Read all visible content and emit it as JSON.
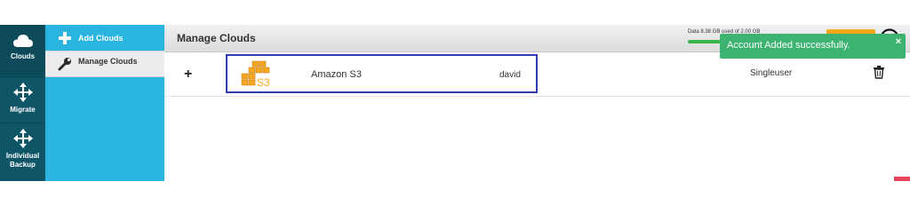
{
  "left_nav": {
    "items": [
      {
        "label": "Clouds",
        "icon": "cloud-icon",
        "active": true
      },
      {
        "label": "Migrate",
        "icon": "move-arrows-icon"
      },
      {
        "label": "Individual Backup",
        "icon": "move-arrows-icon"
      }
    ]
  },
  "sub_nav": {
    "items": [
      {
        "label": "Add Clouds",
        "icon": "plus-icon"
      },
      {
        "label": "Manage Clouds",
        "icon": "wrench-icon",
        "active": true
      }
    ]
  },
  "header": {
    "title": "Manage Clouds",
    "storage_text": "Data 8.38 GB used of 2.00 GB",
    "storage_fraction": 0.9
  },
  "clouds": [
    {
      "name": "Amazon S3",
      "logo_text": "S3",
      "user": "david",
      "type": "Singleuser"
    }
  ],
  "toast": {
    "message": "Account Added successfully.",
    "close": "×"
  },
  "colors": {
    "nav_dark": "#0f5568",
    "sub_nav": "#29b5df",
    "highlight_border": "#2f3db5",
    "toast": "#3cb371",
    "upgrade": "#f3a81b",
    "storage_fill": "#39b54a"
  }
}
